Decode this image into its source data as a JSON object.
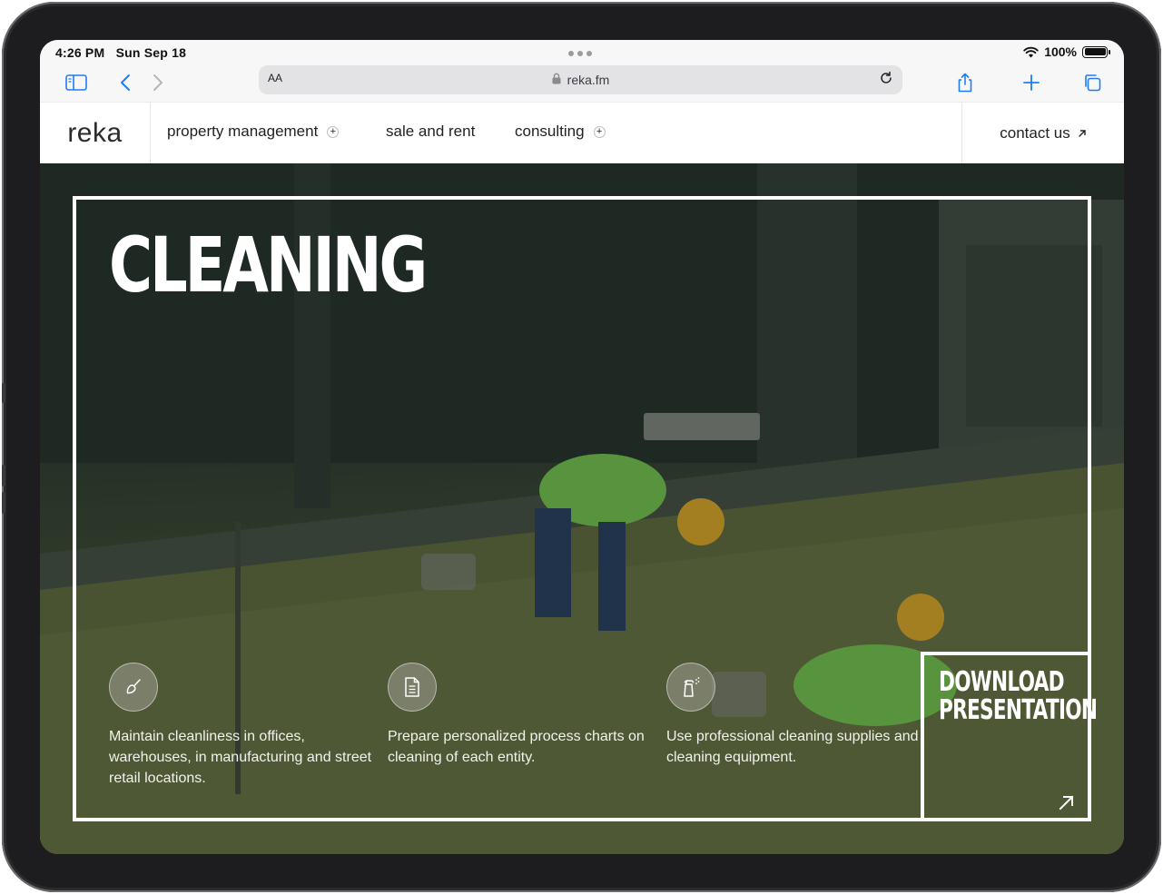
{
  "status_bar": {
    "time": "4:26 PM",
    "date": "Sun Sep 18",
    "battery": "100%"
  },
  "browser": {
    "text_size_label": "AA",
    "url": "reka.fm"
  },
  "nav": {
    "logo": "reka",
    "items": [
      {
        "label": "property management",
        "has_submenu": true
      },
      {
        "label": "sale and rent",
        "has_submenu": false
      },
      {
        "label": "consulting",
        "has_submenu": true
      }
    ],
    "contact_label": "contact us"
  },
  "hero": {
    "title": "CLEANING",
    "features": [
      {
        "icon": "brush-icon",
        "text": "Maintain cleanliness in offices, warehouses, in manufacturing and street retail locations."
      },
      {
        "icon": "document-icon",
        "text": "Prepare personalized process charts on cleaning of each entity."
      },
      {
        "icon": "spray-bottle-icon",
        "text": "Use professional cleaning supplies and cleaning equipment."
      }
    ],
    "download_label": "DOWNLOAD PRESENTATION"
  },
  "colors": {
    "accent_blue": "#1f7bf6",
    "hero_white": "#ffffff",
    "nav_text": "#222222"
  }
}
